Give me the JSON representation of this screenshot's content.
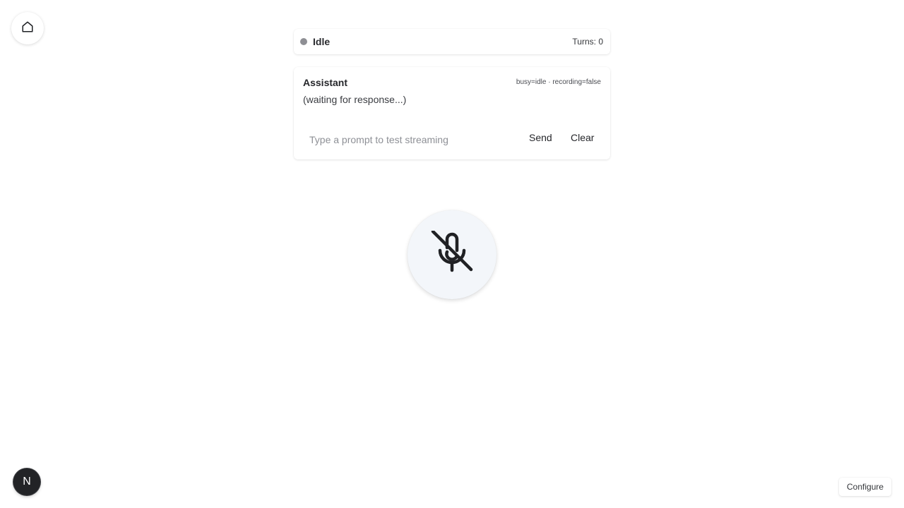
{
  "nav": {
    "home_icon": "home-icon"
  },
  "status": {
    "label": "Idle",
    "turns": "Turns: 0",
    "dot_color": "#8e8f94"
  },
  "assistant": {
    "title": "Assistant",
    "debug": "busy=idle · recording=false",
    "response": "(waiting for response...)"
  },
  "prompt": {
    "placeholder": "Type a prompt to test streaming",
    "value": "",
    "send_label": "Send",
    "clear_label": "Clear"
  },
  "mic": {
    "icon": "mic-off-icon",
    "background": "#f3f6fa"
  },
  "dev_badge": {
    "label": "N"
  },
  "footer": {
    "configure_label": "Configure"
  }
}
